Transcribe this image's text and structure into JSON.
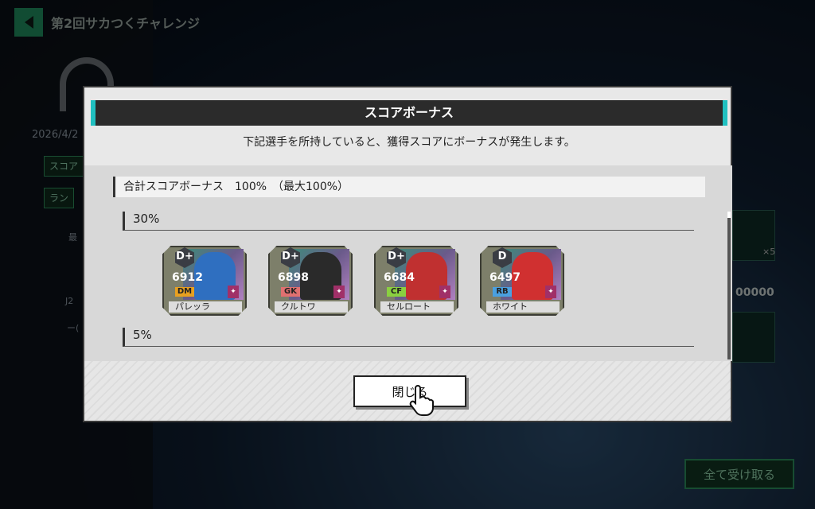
{
  "header": {
    "title": "第2回サカつくチャレンジ"
  },
  "background": {
    "date": "2026/4/2",
    "pill1": "スコア",
    "pill2": "ラン",
    "left_label_1": "最",
    "left_label_2": "J2",
    "left_label_3": "ー(",
    "right_num": "00000",
    "right_count": "×5",
    "receive_button": "全て受け取る"
  },
  "modal": {
    "title": "スコアボーナス",
    "description": "下記選手を所持していると、獲得スコアにボーナスが発生します。",
    "total": "合計スコアボーナス　100%　（最大100%）",
    "sections": [
      {
        "label": "30%"
      },
      {
        "label": "5%"
      }
    ],
    "cards": [
      {
        "rank": "D+",
        "rating": "6912",
        "position": "DM",
        "pos_color": "#e8a020",
        "name": "パレッラ",
        "kit": "#2f6fc0"
      },
      {
        "rank": "D+",
        "rating": "6898",
        "position": "GK",
        "pos_color": "#e07070",
        "name": "クルトワ",
        "kit": "#2a2a2a"
      },
      {
        "rank": "D+",
        "rating": "6684",
        "position": "CF",
        "pos_color": "#8ad040",
        "name": "セルロート",
        "kit": "#c03030"
      },
      {
        "rank": "D",
        "rating": "6497",
        "position": "RB",
        "pos_color": "#4aa0e0",
        "name": "ホワイト",
        "kit": "#d03030"
      }
    ],
    "close_button": "閉じる",
    "colors": {
      "accent": "#20c0c0",
      "header_bg": "#2b2b2b"
    }
  }
}
